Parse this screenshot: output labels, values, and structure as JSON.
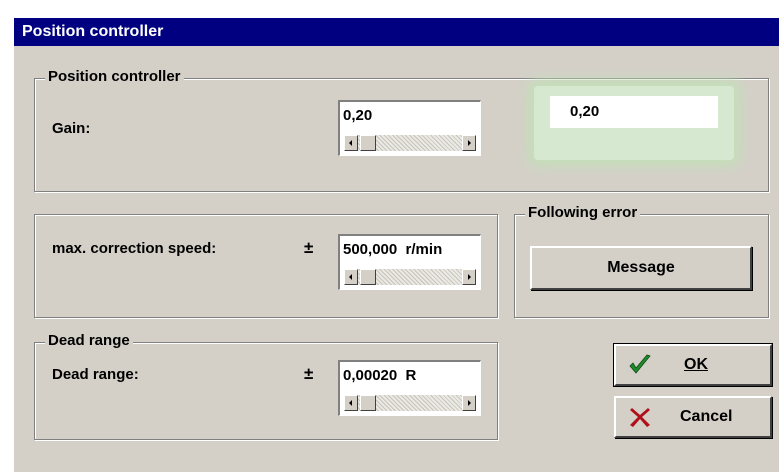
{
  "window": {
    "title": "Position controller"
  },
  "position_group": {
    "title": "Position controller",
    "gain_label": "Gain:",
    "gain_value": "0,20",
    "gain_readout": "0,20"
  },
  "correction_group": {
    "label": "max. correction speed:",
    "plus_minus": "±",
    "value": "500,000  r/min"
  },
  "following_error_group": {
    "title": "Following error",
    "button_label": "Message"
  },
  "dead_range_group": {
    "title": "Dead range",
    "label": "Dead range:",
    "plus_minus": "±",
    "value": "0,00020  R"
  },
  "buttons": {
    "ok_label": "OK",
    "cancel_label": "Cancel",
    "ok_icon": "checkmark-icon",
    "cancel_icon": "red-x-icon"
  },
  "colors": {
    "titlebar": "#000080",
    "dialog_bg": "#d4d0c8",
    "check_green": "#1f8a2a",
    "cancel_red": "#b0101a",
    "readout_glow": "#c3e0b8"
  }
}
